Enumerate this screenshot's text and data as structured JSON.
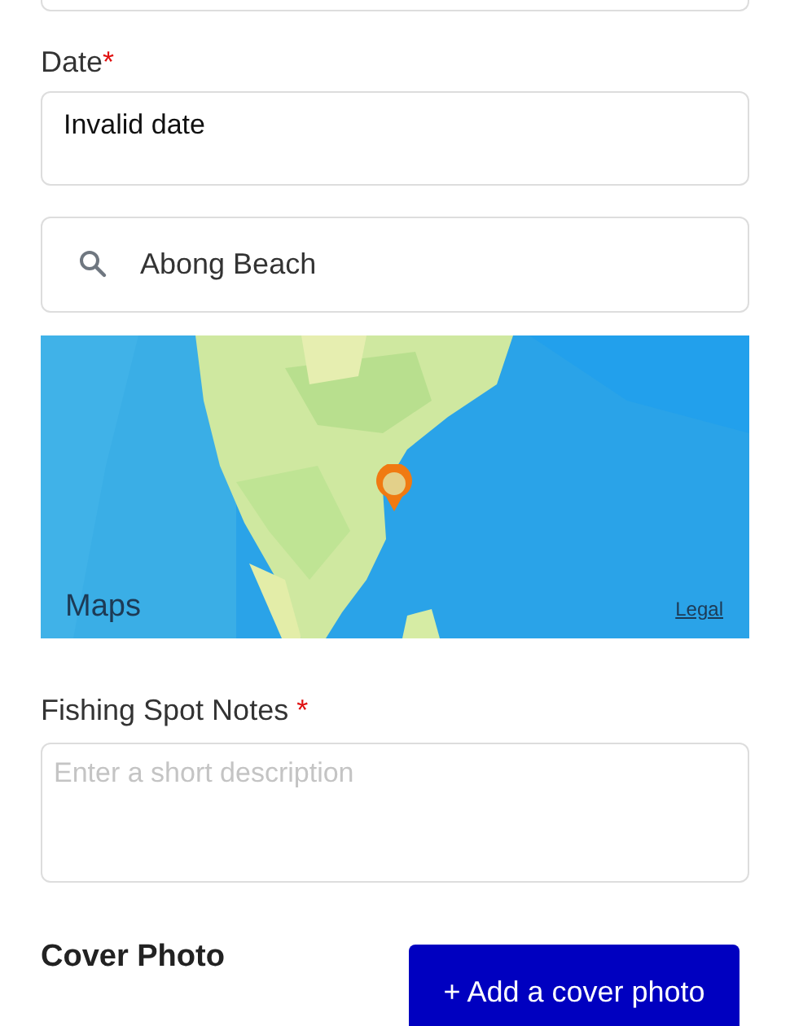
{
  "date_field": {
    "label": "Date",
    "required_mark": "*",
    "value": "Invalid date"
  },
  "location_search": {
    "value": "Abong Beach"
  },
  "map": {
    "logo_text": "Maps",
    "legal_link": "Legal"
  },
  "notes_field": {
    "label": "Fishing Spot Notes",
    "required_mark": "*",
    "placeholder": "Enter a short description"
  },
  "cover_photo": {
    "heading": "Cover Photo",
    "button": "+ Add a cover photo"
  }
}
